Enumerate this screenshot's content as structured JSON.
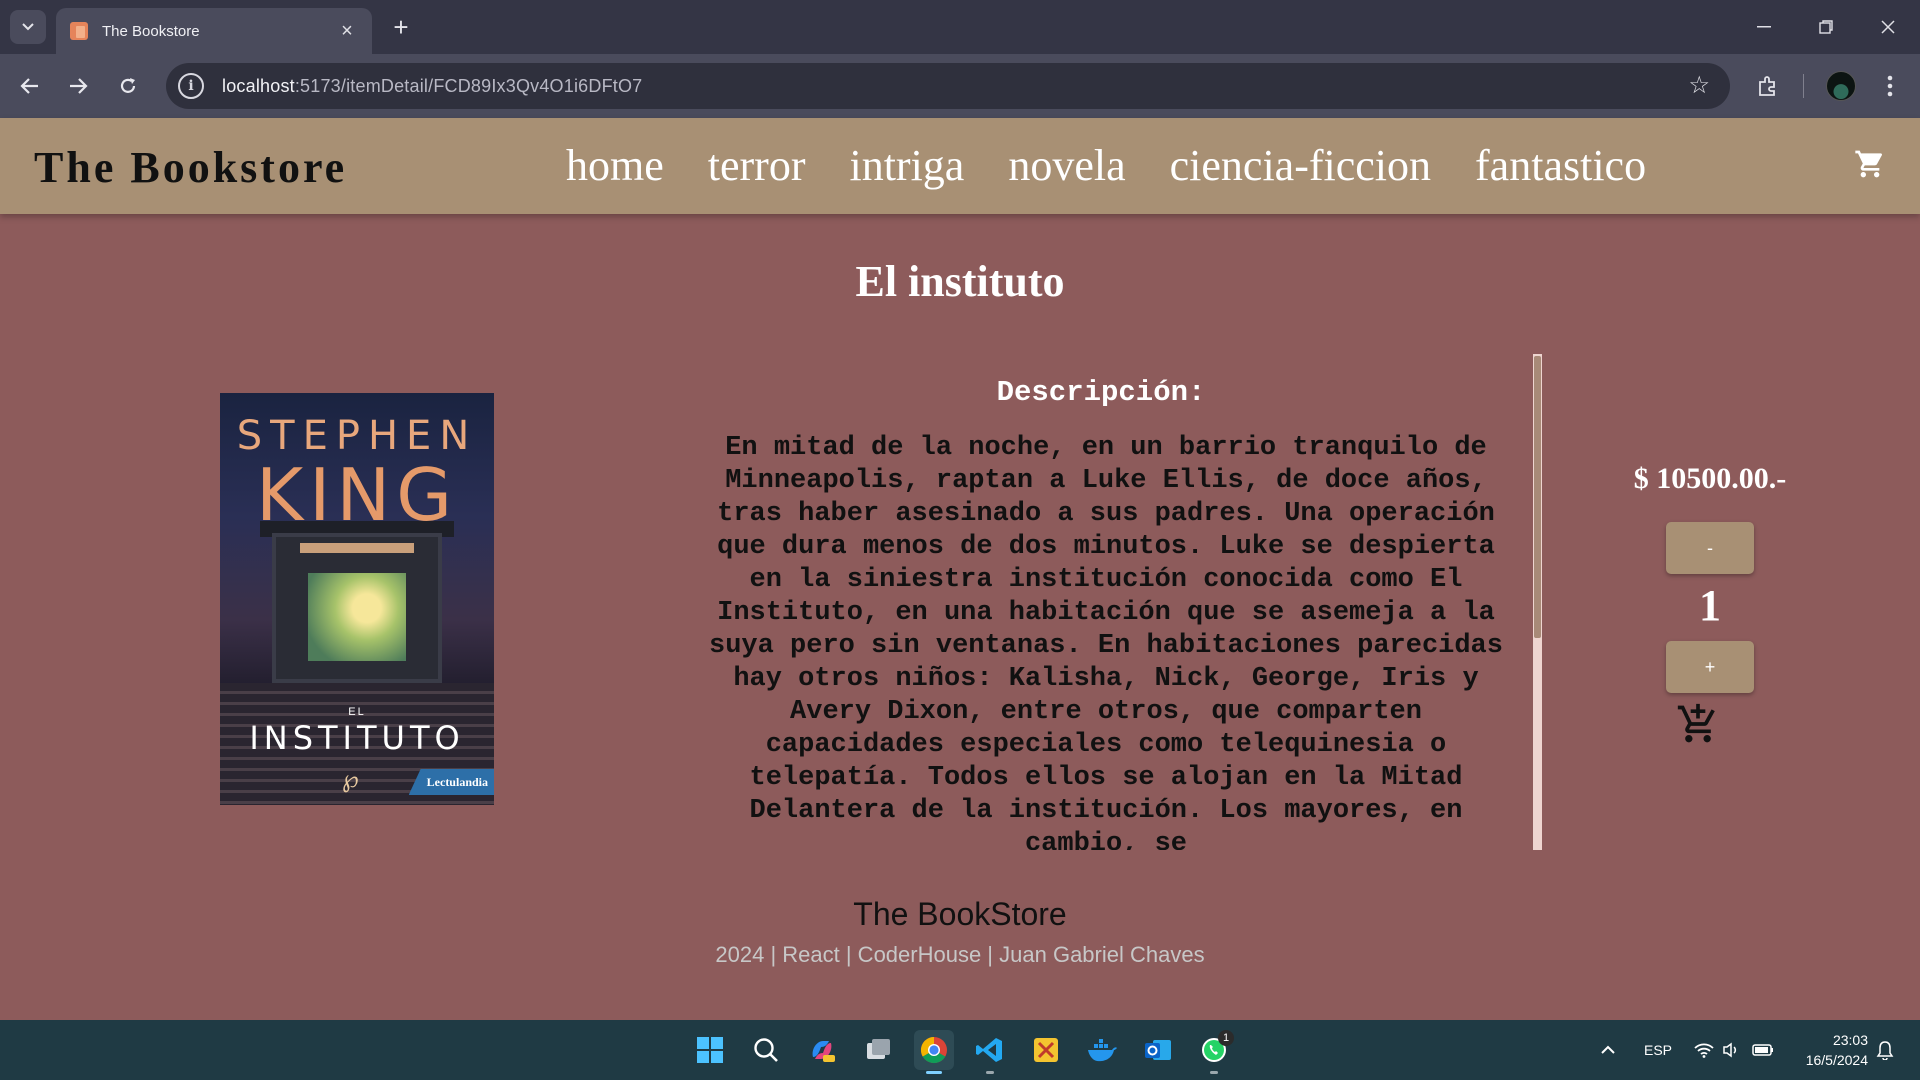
{
  "browser": {
    "tab_title": "The Bookstore",
    "url_host": "localhost",
    "url_path": ":5173/itemDetail/FCD89Ix3Qv4O1i6DFtO7"
  },
  "site": {
    "brand": "The Bookstore",
    "menu": [
      "home",
      "terror",
      "intriga",
      "novela",
      "ciencia-ficcion",
      "fantastico"
    ]
  },
  "product": {
    "title": "El instituto",
    "cover": {
      "author_first": "STEPHEN",
      "author_last": "KING",
      "el": "EL",
      "title": "INSTITUTO",
      "badge": "Lectulandia"
    },
    "description_label": "Descripción:",
    "description": "En mitad de la noche, en un barrio tranquilo de Minneapolis, raptan a Luke Ellis, de doce años, tras haber asesinado a sus padres. Una operación que dura menos de dos minutos. Luke se despierta en la siniestra institución conocida como El Instituto, en una habitación que se asemeja a la suya pero sin ventanas. En habitaciones parecidas hay otros niños: Kalisha, Nick, George, Iris y Avery Dixon, entre otros, que comparten capacidades especiales como telequinesia o telepatía. Todos ellos se alojan en la Mitad Delantera de la institución. Los mayores, en cambio, se",
    "price": "$ 10500.00.-",
    "decrement_label": "-",
    "quantity": "1",
    "increment_label": "+"
  },
  "footer": {
    "title": "The BookStore",
    "credits": "2024 | React | CoderHouse | Juan Gabriel Chaves"
  },
  "taskbar": {
    "language": "ESP",
    "time": "23:03",
    "date": "16/5/2024",
    "whatsapp_badge": "1"
  },
  "colors": {
    "page_bg": "#8d5b5b",
    "navbar_bg": "#a89074",
    "button_bg": "#a89074"
  }
}
